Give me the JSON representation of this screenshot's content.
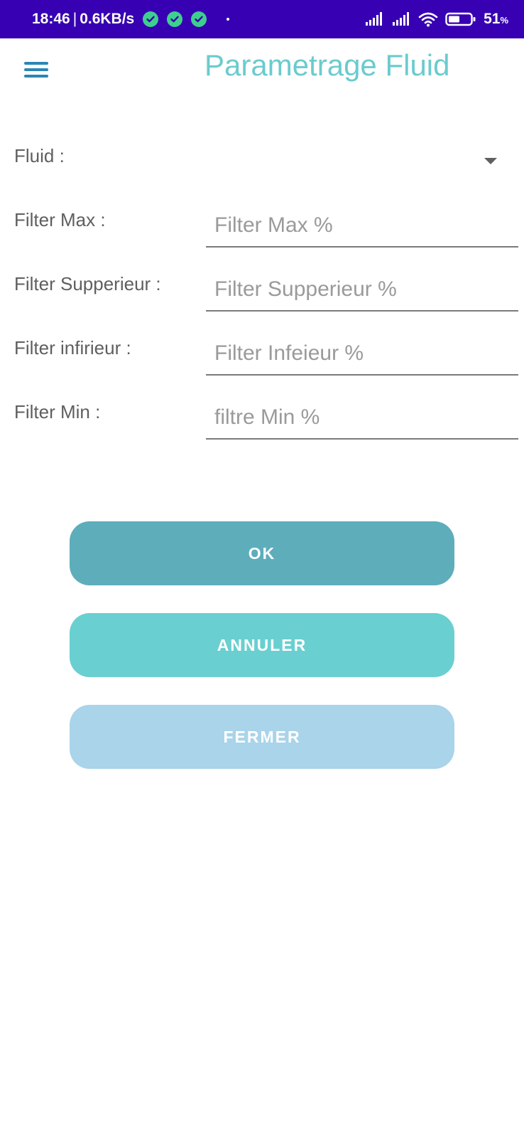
{
  "status_bar": {
    "time": "18:46",
    "separator": "|",
    "network_speed": "0.6KB/s",
    "notification_icons": [
      "check-circle-icon",
      "check-circle-icon",
      "check-circle-icon"
    ],
    "signal_icons": [
      "signal-icon",
      "signal-icon",
      "wifi-icon",
      "battery-icon"
    ],
    "battery_level": "51",
    "battery_unit": "%"
  },
  "header": {
    "menu_icon": "hamburger-menu-icon",
    "title": "Parametrage Fluid"
  },
  "form": {
    "fluid": {
      "label": "Fluid :",
      "selected_value": ""
    },
    "filter_max": {
      "label": "Filter Max :",
      "value": "",
      "placeholder": "Filter Max %"
    },
    "filter_superieur": {
      "label": "Filter Supperieur :",
      "value": "",
      "placeholder": "Filter Supperieur %"
    },
    "filter_inferieur": {
      "label": "Filter infirieur :",
      "value": "",
      "placeholder": "Filter Infeieur %"
    },
    "filter_min": {
      "label": "Filter Min :",
      "value": "",
      "placeholder": "filtre Min %"
    }
  },
  "buttons": {
    "ok": "OK",
    "annuler": "ANNULER",
    "fermer": "FERMER"
  },
  "colors": {
    "status_bar": "#3700b3",
    "title": "#6bcbcf",
    "menu_icon": "#2a86b5",
    "ok_button": "#5eadbb",
    "annuler_button": "#6acfd0",
    "fermer_button": "#a9d4ea"
  }
}
